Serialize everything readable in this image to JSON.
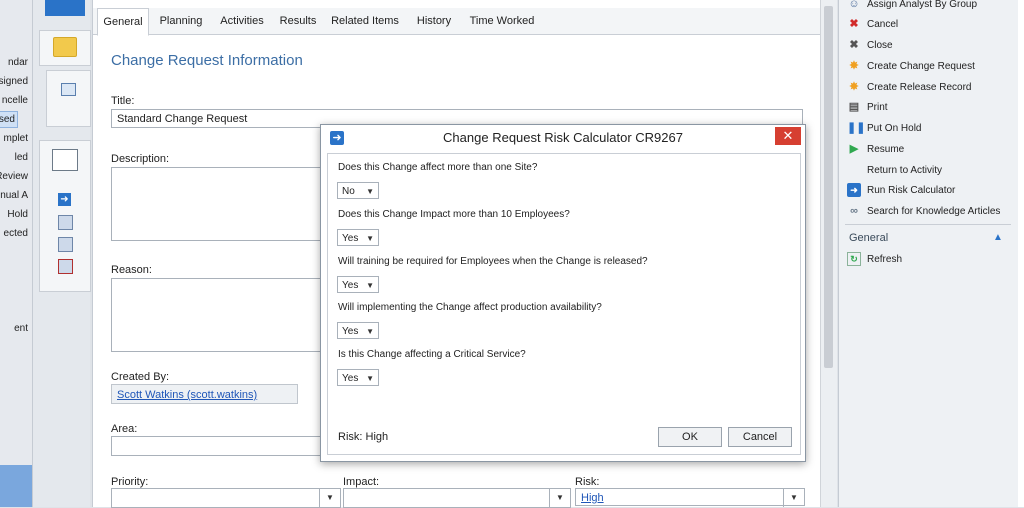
{
  "left_nav": {
    "items": [
      "ndar",
      "signed",
      "ncelle",
      "osed",
      "mplet",
      "led",
      "Review",
      "nual A",
      "Hold",
      "ected",
      "ent"
    ]
  },
  "tabs": [
    "General",
    "Planning",
    "Activities",
    "Results",
    "Related Items",
    "History",
    "Time Worked"
  ],
  "form": {
    "section_title": "Change Request Information",
    "title_label": "Title:",
    "title_value": "Standard Change Request",
    "description_label": "Description:",
    "reason_label": "Reason:",
    "created_by_label": "Created By:",
    "created_by_value": "Scott Watkins (scott.watkins)",
    "area_label": "Area:",
    "priority_label": "Priority:",
    "impact_label": "Impact:",
    "risk_label": "Risk:",
    "risk_value": "High"
  },
  "tasks": {
    "items": [
      "Assign Analyst By Group",
      "Cancel",
      "Close",
      "Create Change Request",
      "Create Release Record",
      "Print",
      "Put On Hold",
      "Resume",
      "Return to Activity",
      "Run Risk Calculator",
      "Search for Knowledge Articles"
    ],
    "general_header": "General",
    "general_items": [
      "Refresh"
    ]
  },
  "dialog": {
    "title": "Change Request Risk Calculator CR9267",
    "questions": [
      {
        "text": "Does this Change affect more than one Site?",
        "answer": "No"
      },
      {
        "text": "Does this Change Impact more than 10 Employees?",
        "answer": "Yes"
      },
      {
        "text": "Will training be required for Employees when the Change is released?",
        "answer": "Yes"
      },
      {
        "text": "Will implementing the Change affect production availability?",
        "answer": "Yes"
      },
      {
        "text": "Is this Change affecting a Critical Service?",
        "answer": "Yes"
      }
    ],
    "risk_text": "Risk: High",
    "ok_label": "OK",
    "cancel_label": "Cancel"
  }
}
